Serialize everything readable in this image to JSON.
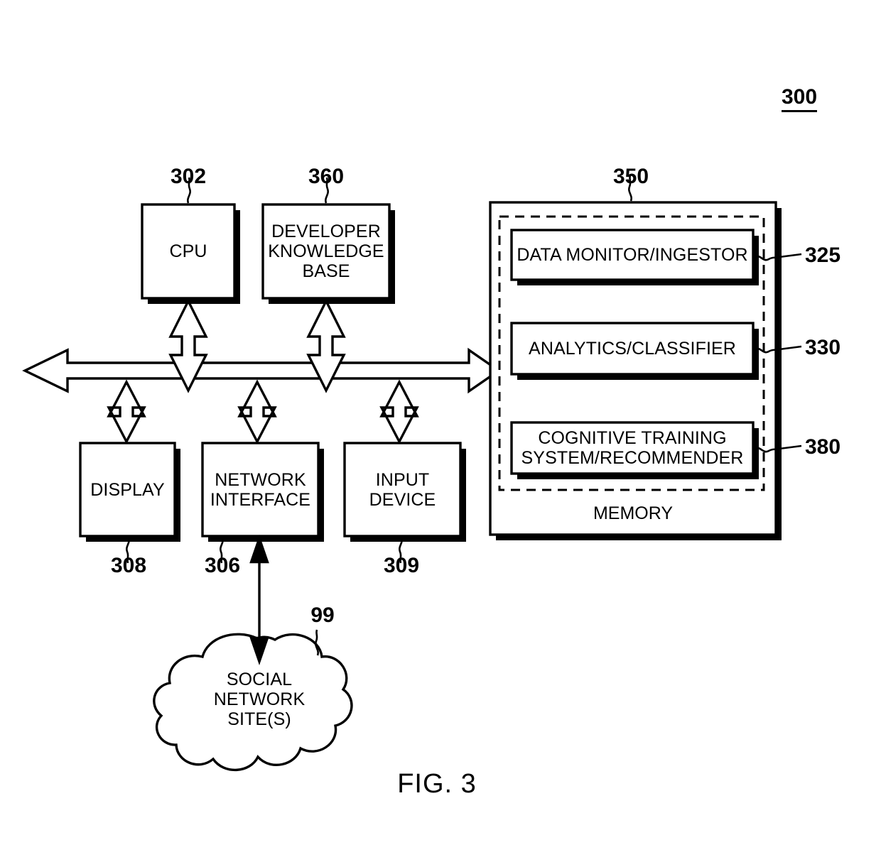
{
  "figure": {
    "id": "300",
    "caption": "FIG. 3"
  },
  "blocks": {
    "cpu": {
      "label": "CPU",
      "ref": "302"
    },
    "developer_knowledge_base": {
      "label": "DEVELOPER\nKNOWLEDGE\nBASE",
      "ref": "360"
    },
    "display": {
      "label": "DISPLAY",
      "ref": "308"
    },
    "network_interface": {
      "label": "NETWORK\nINTERFACE",
      "ref": "306"
    },
    "input_device": {
      "label": "INPUT\nDEVICE",
      "ref": "309"
    },
    "memory": {
      "label": "MEMORY",
      "ref": "350"
    },
    "social_network": {
      "label": "SOCIAL\nNETWORK\nSITE(S)",
      "ref": "99"
    }
  },
  "memory_modules": [
    {
      "label": "DATA MONITOR/INGESTOR",
      "ref": "325"
    },
    {
      "label": "ANALYTICS/CLASSIFIER",
      "ref": "330"
    },
    {
      "label": "COGNITIVE TRAINING\nSYSTEM/RECOMMENDER",
      "ref": "380"
    }
  ],
  "colors": {
    "stroke": "#000000",
    "fill": "#ffffff",
    "background": "#ffffff"
  }
}
